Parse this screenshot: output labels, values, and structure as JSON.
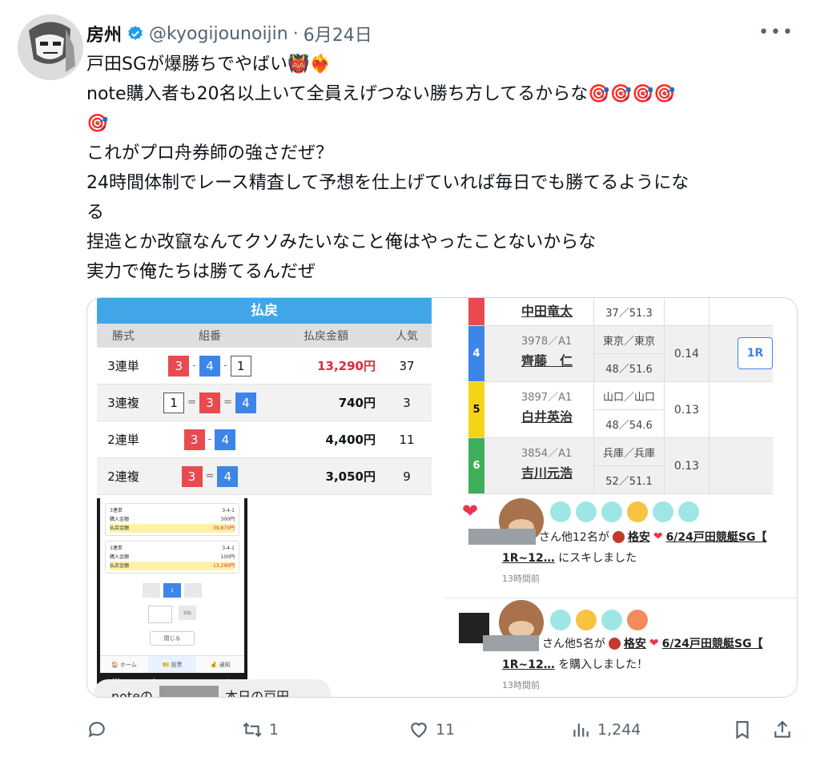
{
  "tweet": {
    "display_name": "房州",
    "handle": "@kyogijounoijin",
    "separator": "·",
    "date": "6月24日",
    "more_label": "•••",
    "lines": [
      "戸田SGが爆勝ちでやばい👹❤️‍🔥",
      "note購入者も20名以上いて全員えげつない勝ち方してるからな🎯🎯🎯🎯",
      "🎯",
      "これがプロ舟券師の強さだぜ？",
      "24時間体制でレース精査して予想を仕上げていれば毎日でも勝てるようにな",
      "る",
      "捏造とか改竄なんてクソみたいなこと俺はやったことないからな",
      "実力で俺たちは勝てるんだぜ"
    ]
  },
  "payout": {
    "title": "払戻",
    "headers": [
      "勝式",
      "組番",
      "払戻金額",
      "人気"
    ],
    "rows": [
      {
        "type": "3連単",
        "nums": [
          "3",
          "4",
          "1"
        ],
        "sep": "-",
        "amount": "13,290円",
        "pop": "37"
      },
      {
        "type": "3連複",
        "nums": [
          "1",
          "3",
          "4"
        ],
        "sep": "=",
        "amount": "740円",
        "pop": "3"
      },
      {
        "type": "2連単",
        "nums": [
          "3",
          "4"
        ],
        "sep": "-",
        "amount": "4,400円",
        "pop": "11"
      },
      {
        "type": "2連複",
        "nums": [
          "3",
          "4"
        ],
        "sep": "=",
        "amount": "3,050円",
        "pop": "9"
      }
    ]
  },
  "racers": {
    "top_name": "中田竜太",
    "top_stat": "37／51.3",
    "race_button": "1R",
    "rows": [
      {
        "lane": "4",
        "id": "3978／A1",
        "name": "齊藤　仁",
        "home": "東京／東京",
        "stat": "48／51.6",
        "st": "0.14"
      },
      {
        "lane": "5",
        "id": "3897／A1",
        "name": "白井英治",
        "home": "山口／山口",
        "stat": "48／54.6",
        "st": "0.13"
      },
      {
        "lane": "6",
        "id": "3854／A1",
        "name": "吉川元浩",
        "home": "兵庫／兵庫",
        "stat": "52／51.1",
        "st": "0.13"
      }
    ]
  },
  "phone": {
    "ticket1": {
      "kind": "3連単",
      "combo": "3-4-1",
      "buy_label": "購入金額",
      "buy": "300円",
      "pay_label": "払戻金額",
      "pay": "39,870円"
    },
    "ticket2": {
      "kind": "3連単",
      "combo": "3-4-1",
      "buy_label": "購入金額",
      "buy": "100円",
      "pay_label": "払戻金額",
      "pay": "13,290円"
    },
    "page_current": "1",
    "go_label": "移動",
    "close_label": "閉じる",
    "tabs": [
      "🏠 ホーム",
      "🎫 投票",
      "💰 通知"
    ],
    "nav": [
      "|||",
      "○",
      "<",
      "★"
    ],
    "note_prefix": "noteの",
    "note_suffix": "本日の戸田"
  },
  "notifications": [
    {
      "text_mid": "さん他12名が",
      "title_a": "格安",
      "title_b": "6/24戸田競艇SG【",
      "title_c": "1R~12…",
      "tail": "にスキしました",
      "time": "13時間前"
    },
    {
      "text_mid": "さん他5名が",
      "title_a": "格安",
      "title_b": "6/24戸田競艇SG【",
      "title_c": "1R~12…",
      "tail": "を購入しました！",
      "time": "13時間前"
    }
  ],
  "stats": {
    "replies": "",
    "retweets": "1",
    "likes": "11",
    "views": "1,244"
  },
  "colors": {
    "verified": "#1d9bf0",
    "accent_red": "#e02a3a",
    "lane4": "#3d85e8",
    "lane5": "#f5d418",
    "lane6": "#3fae5a",
    "lane3": "#e84a50"
  }
}
